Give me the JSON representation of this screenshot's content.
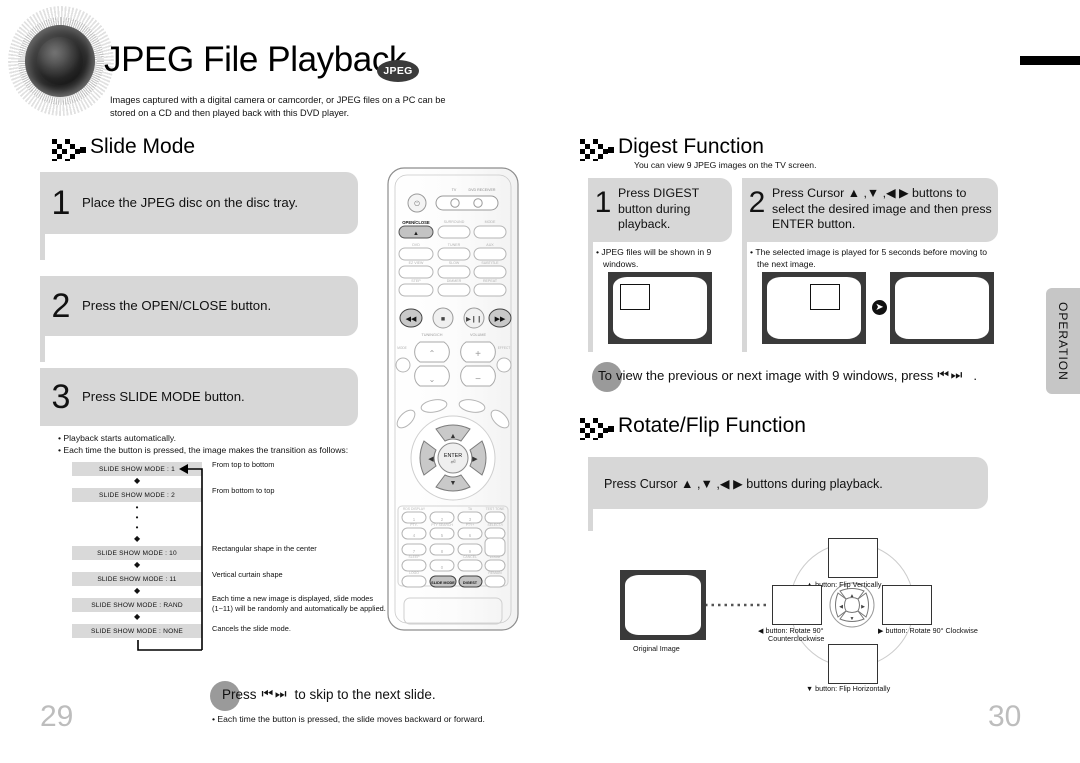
{
  "header": {
    "title": "JPEG File Playback",
    "badge": "JPEG",
    "intro": "Images captured with a digital camera or camcorder, or JPEG files on a PC can be stored on a CD and then played back with this DVD player.",
    "disc_icon": "disc-lens-icon"
  },
  "slide_mode": {
    "section_title": "Slide Mode",
    "steps": [
      {
        "num": "1",
        "text": "Place the JPEG disc on the disc tray."
      },
      {
        "num": "2",
        "text": "Press the OPEN/CLOSE button."
      },
      {
        "num": "3",
        "text": "Press SLIDE MODE button."
      }
    ],
    "notes": [
      "Playback starts automatically.",
      "Each time the button is pressed, the image makes the transition as follows:"
    ],
    "flow": [
      {
        "label": "SLIDE SHOW MODE : 1",
        "desc": "From top to bottom"
      },
      {
        "label": "SLIDE SHOW MODE : 2",
        "desc": "From bottom to top"
      },
      {
        "label": "SLIDE SHOW MODE : 10",
        "desc": "Rectangular shape in the center"
      },
      {
        "label": "SLIDE SHOW MODE : 11",
        "desc": "Vertical curtain shape"
      },
      {
        "label": "SLIDE SHOW MODE : RAND",
        "desc": "Each time a new image is displayed, slide modes (1~11) will be randomly and automatically be applied."
      },
      {
        "label": "SLIDE SHOW MODE : NONE",
        "desc": "Cancels the slide mode."
      }
    ],
    "skip_callout": "to skip to the next slide.",
    "skip_press": "Press",
    "skip_icons": "prev-next-icon",
    "skip_note": "Each time the button is pressed, the slide moves backward or forward."
  },
  "digest": {
    "section_title": "Digest Function",
    "section_sub": "You can view 9 JPEG images on the TV screen.",
    "steps": [
      {
        "num": "1",
        "text": "Press DIGEST button during playback.",
        "note": "JPEG files will be shown in 9 windows."
      },
      {
        "num": "2",
        "text": "Press Cursor ▲ ,▼ ,◀ ▶  buttons to select the desired image and then press ENTER button.",
        "note": "The selected image is played for 5 seconds before moving to the next image."
      }
    ],
    "callout_pre": "To",
    "callout": "view the previous or next image with 9 windows, press",
    "callout_icons": "prev-next-icon",
    "callout_end": "."
  },
  "rotate": {
    "section_title": "Rotate/Flip Function",
    "callout": "Press Cursor ▲ ,▼ ,◀ ▶  buttons during playback.",
    "original_label": "Original Image",
    "labels": {
      "up": "▲ button: Flip Vertically",
      "down": "▼ button: Flip Horizontally",
      "left_line1": "◀ button: Rotate 90°",
      "left_line2": "Counterclockwise",
      "right": "▶ button: Rotate 90° Clockwise"
    },
    "dpad_icon": "dpad-icon"
  },
  "remote": {
    "icon": "remote-control-illustration",
    "labels": {
      "open_close": "OPEN/CLOSE",
      "power": "power-icon",
      "tv": "TV",
      "dvd_receiver": "DVD RECEIVER",
      "enter": "ENTER",
      "slide_mode": "SLIDE MODE",
      "digest": "DIGEST"
    }
  },
  "side_tab": {
    "label": "OPERATION"
  },
  "page_numbers": {
    "left": "29",
    "right": "30"
  },
  "colors": {
    "panel_gray": "#d7d7d7",
    "flow_gray": "#d9d9d9",
    "tab_gray": "#c6c6c6",
    "page_number": "#bdbdbd",
    "badge": "#3b3b3b"
  }
}
